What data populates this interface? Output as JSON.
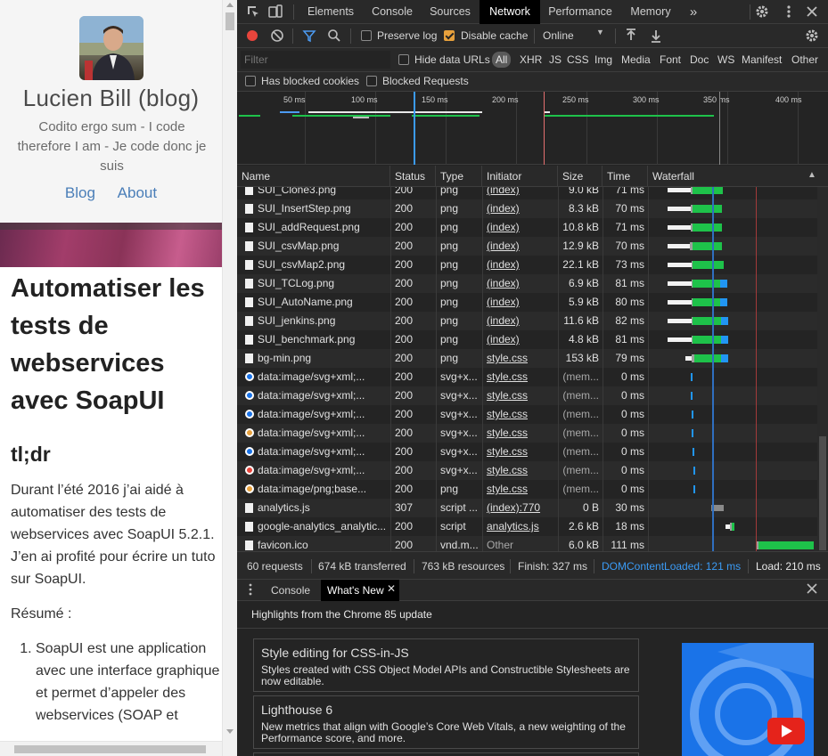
{
  "blog": {
    "title": "Lucien Bill (blog)",
    "tagline": "Codito ergo sum - I code therefore I am - Je code donc je suis",
    "nav": [
      "Blog",
      "About"
    ],
    "article_title": "Automatiser les tests de webservices avec SoapUI",
    "tldr": "tl;dr",
    "intro": "Durant l’été 2016 j’ai aidé à automatiser des tests de webservices avec SoapUI 5.2.1. J’en ai profité pour écrire un tuto sur SoapUI.",
    "resume": "Résumé :",
    "list_item_1": "SoapUI est une application avec une interface graphique et permet d’appeler des webservices (SOAP et"
  },
  "devtools": {
    "tabs": [
      "Elements",
      "Console",
      "Sources",
      "Network",
      "Performance",
      "Memory"
    ],
    "active_tab": "Network",
    "more_tabs": "»",
    "toolbar": {
      "preserve_log": "Preserve log",
      "disable_cache": "Disable cache",
      "throttling": "Online"
    },
    "filter": {
      "placeholder": "Filter",
      "hide_data_urls": "Hide data URLs",
      "types": [
        "All",
        "XHR",
        "JS",
        "CSS",
        "Img",
        "Media",
        "Font",
        "Doc",
        "WS",
        "Manifest",
        "Other"
      ],
      "has_blocked_cookies": "Has blocked cookies",
      "blocked_requests": "Blocked Requests"
    },
    "overview_ticks": [
      "50 ms",
      "100 ms",
      "150 ms",
      "200 ms",
      "250 ms",
      "300 ms",
      "350 ms",
      "400 ms"
    ],
    "columns": [
      "Name",
      "Status",
      "Type",
      "Initiator",
      "Size",
      "Time",
      "Waterfall"
    ],
    "rows": [
      {
        "name": "SUI_Clone3.png",
        "status": "200",
        "type": "png",
        "initiator": "(index)",
        "size": "9.0 kB",
        "time": "71 ms",
        "icon": "file"
      },
      {
        "name": "SUI_InsertStep.png",
        "status": "200",
        "type": "png",
        "initiator": "(index)",
        "size": "8.3 kB",
        "time": "70 ms",
        "icon": "file"
      },
      {
        "name": "SUI_addRequest.png",
        "status": "200",
        "type": "png",
        "initiator": "(index)",
        "size": "10.8 kB",
        "time": "71 ms",
        "icon": "file"
      },
      {
        "name": "SUI_csvMap.png",
        "status": "200",
        "type": "png",
        "initiator": "(index)",
        "size": "12.9 kB",
        "time": "70 ms",
        "icon": "file"
      },
      {
        "name": "SUI_csvMap2.png",
        "status": "200",
        "type": "png",
        "initiator": "(index)",
        "size": "22.1 kB",
        "time": "73 ms",
        "icon": "file"
      },
      {
        "name": "SUI_TCLog.png",
        "status": "200",
        "type": "png",
        "initiator": "(index)",
        "size": "6.9 kB",
        "time": "81 ms",
        "icon": "file"
      },
      {
        "name": "SUI_AutoName.png",
        "status": "200",
        "type": "png",
        "initiator": "(index)",
        "size": "5.9 kB",
        "time": "80 ms",
        "icon": "file"
      },
      {
        "name": "SUI_jenkins.png",
        "status": "200",
        "type": "png",
        "initiator": "(index)",
        "size": "11.6 kB",
        "time": "82 ms",
        "icon": "file"
      },
      {
        "name": "SUI_benchmark.png",
        "status": "200",
        "type": "png",
        "initiator": "(index)",
        "size": "4.8 kB",
        "time": "81 ms",
        "icon": "file"
      },
      {
        "name": "bg-min.png",
        "status": "200",
        "type": "png",
        "initiator": "style.css",
        "size": "153 kB",
        "time": "79 ms",
        "icon": "image"
      },
      {
        "name": "data:image/svg+xml;...",
        "status": "200",
        "type": "svg+x...",
        "initiator": "style.css",
        "size": "(mem...",
        "time": "0 ms",
        "icon": "blue"
      },
      {
        "name": "data:image/svg+xml;...",
        "status": "200",
        "type": "svg+x...",
        "initiator": "style.css",
        "size": "(mem...",
        "time": "0 ms",
        "icon": "blue"
      },
      {
        "name": "data:image/svg+xml;...",
        "status": "200",
        "type": "svg+x...",
        "initiator": "style.css",
        "size": "(mem...",
        "time": "0 ms",
        "icon": "blue"
      },
      {
        "name": "data:image/svg+xml;...",
        "status": "200",
        "type": "svg+x...",
        "initiator": "style.css",
        "size": "(mem...",
        "time": "0 ms",
        "icon": "orange"
      },
      {
        "name": "data:image/svg+xml;...",
        "status": "200",
        "type": "svg+x...",
        "initiator": "style.css",
        "size": "(mem...",
        "time": "0 ms",
        "icon": "blue"
      },
      {
        "name": "data:image/svg+xml;...",
        "status": "200",
        "type": "svg+x...",
        "initiator": "style.css",
        "size": "(mem...",
        "time": "0 ms",
        "icon": "red"
      },
      {
        "name": "data:image/png;base...",
        "status": "200",
        "type": "png",
        "initiator": "style.css",
        "size": "(mem...",
        "time": "0 ms",
        "icon": "orange"
      },
      {
        "name": "analytics.js",
        "status": "307",
        "type": "script ...",
        "initiator": "(index):770",
        "size": "0 B",
        "time": "30 ms",
        "icon": "file"
      },
      {
        "name": "google-analytics_analytic...",
        "status": "200",
        "type": "script",
        "initiator": "analytics.js",
        "size": "2.6 kB",
        "time": "18 ms",
        "icon": "file"
      },
      {
        "name": "favicon.ico",
        "status": "200",
        "type": "vnd.m...",
        "initiator": "Other",
        "size": "6.0 kB",
        "time": "111 ms",
        "icon": "file"
      }
    ],
    "status": {
      "requests": "60 requests",
      "transferred": "674 kB transferred",
      "resources": "763 kB resources",
      "finish": "Finish: 327 ms",
      "dcl": "DOMContentLoaded: 121 ms",
      "load": "Load: 210 ms"
    },
    "drawer": {
      "tabs": [
        "Console",
        "What's New"
      ],
      "active_tab": "What's New",
      "heading": "Highlights from the Chrome 85 update",
      "cards": [
        {
          "title": "Style editing for CSS-in-JS",
          "desc": "Styles created with CSS Object Model APIs and Constructible Stylesheets are now editable."
        },
        {
          "title": "Lighthouse 6",
          "desc": "New metrics that align with Google’s Core Web Vitals, a new weighting of the Performance score, and more."
        }
      ]
    },
    "colors": {
      "accent_blue": "#1a73e8",
      "dcl_blue": "#3b9bf5",
      "load_red": "#e46f6f",
      "waiting_green": "#1ec24a",
      "download_blue": "#2196f3",
      "active_tab_orange": "#e7a03c"
    }
  }
}
